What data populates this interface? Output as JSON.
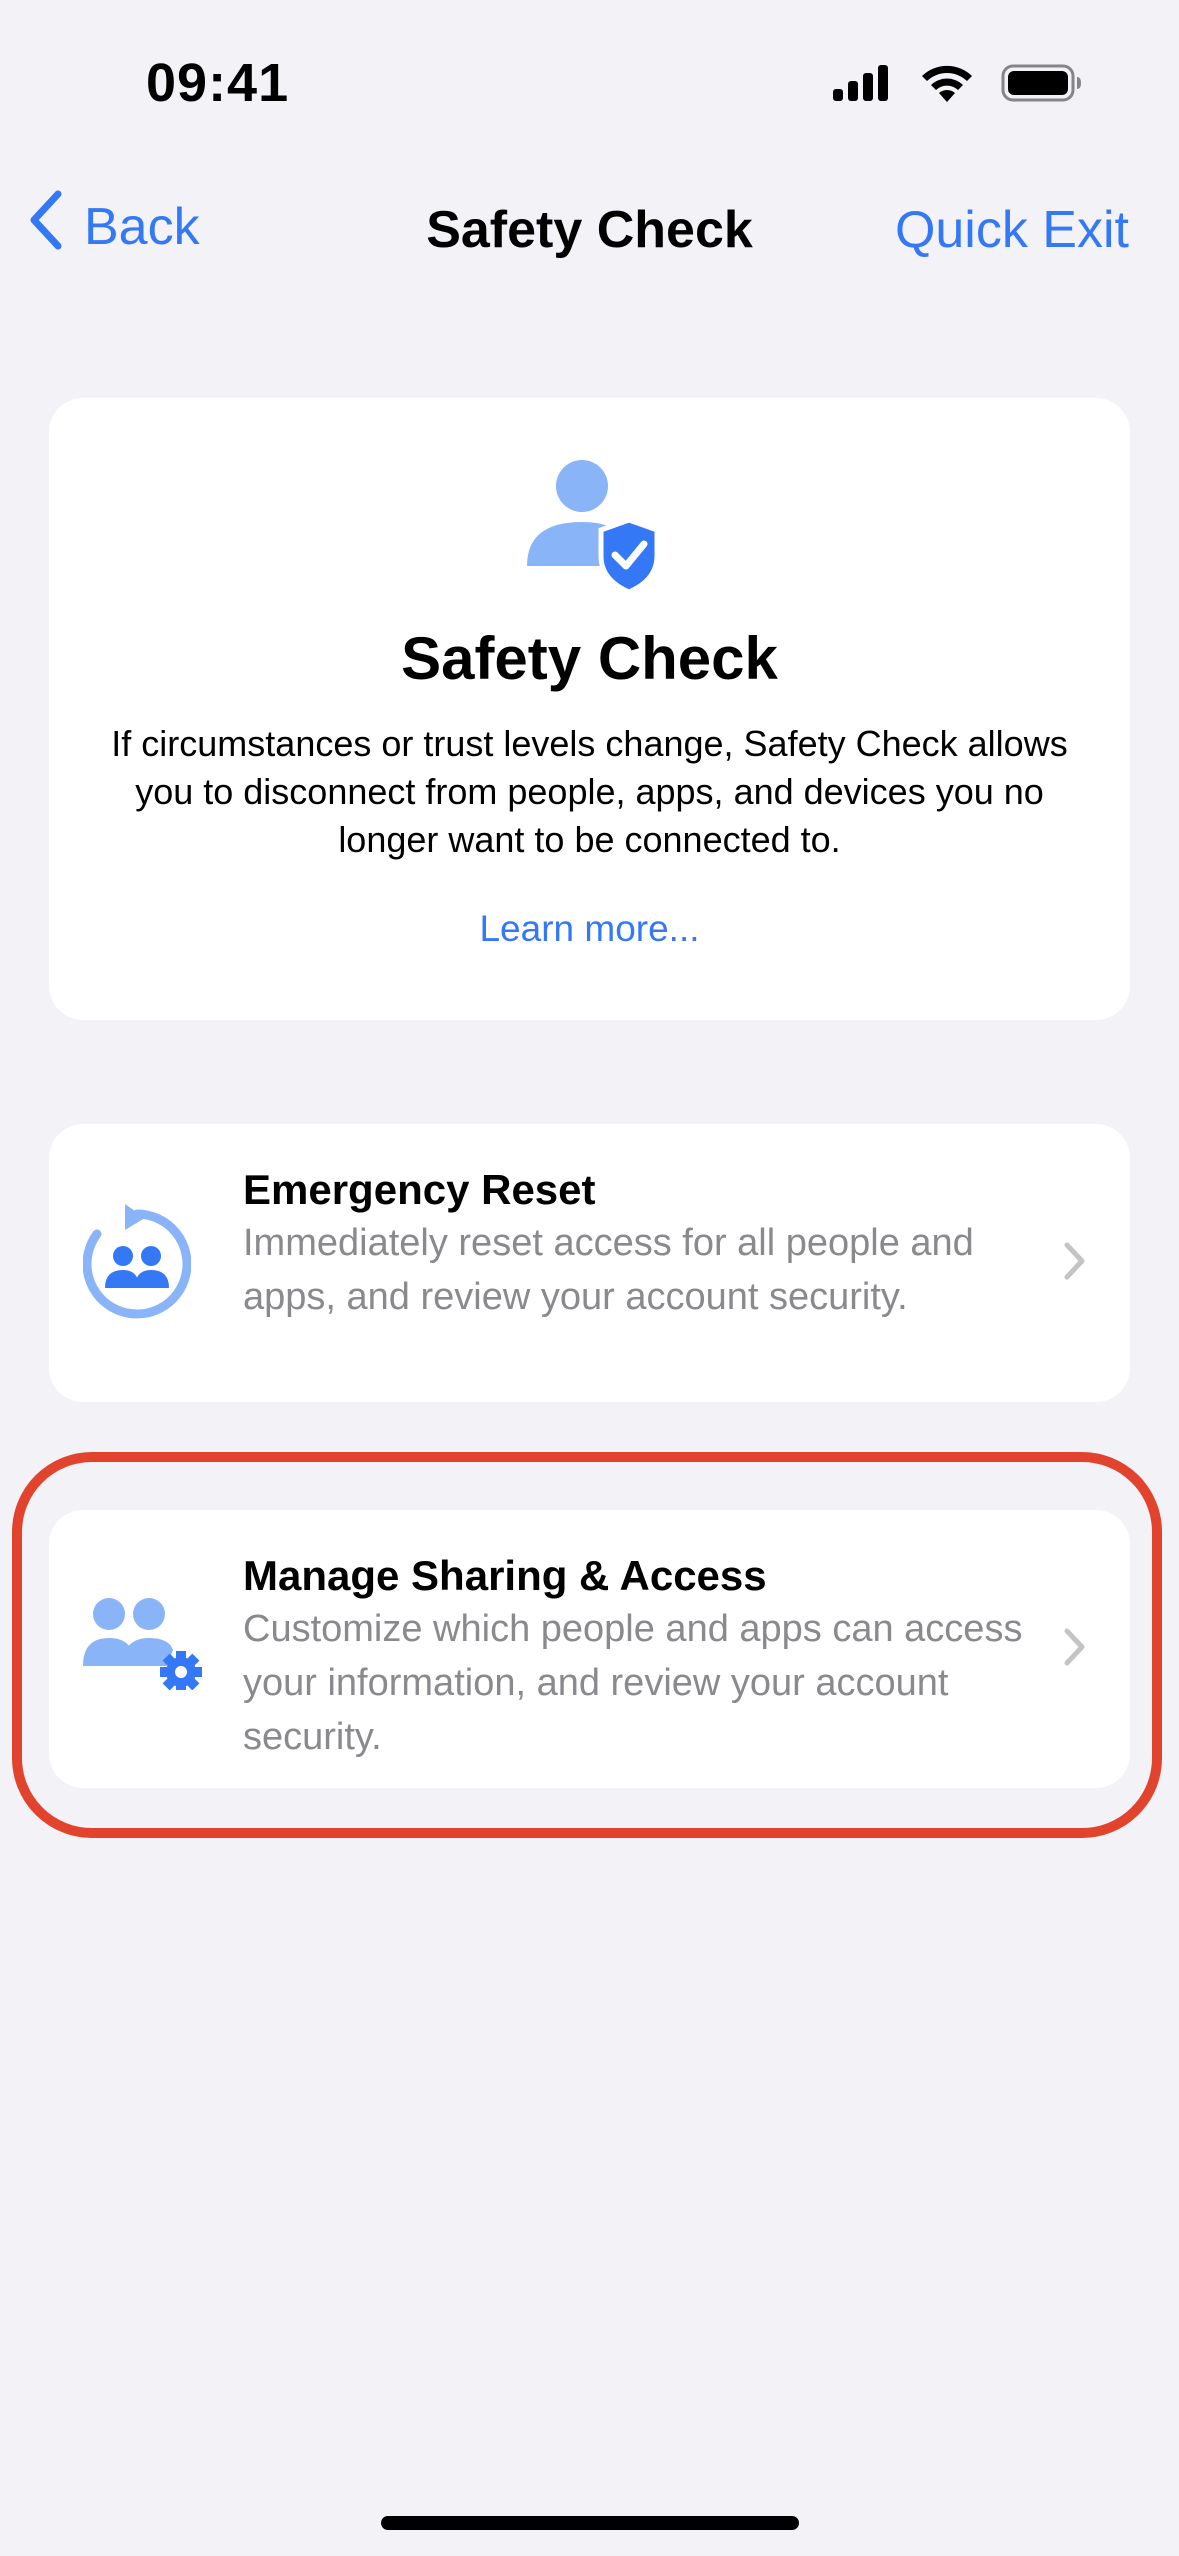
{
  "status_bar": {
    "time": "09:41",
    "icons": [
      "cellular-signal-icon",
      "wifi-icon",
      "battery-icon"
    ]
  },
  "nav": {
    "back_label": "Back",
    "title": "Safety Check",
    "quick_exit_label": "Quick Exit"
  },
  "hero": {
    "icon": "person-shield-icon",
    "title": "Safety Check",
    "description": "If circumstances or trust levels change, Safety Check allows you to disconnect from people, apps, and devices you no longer want to be connected to.",
    "link": "Learn more..."
  },
  "options": [
    {
      "icon": "emergency-reset-icon",
      "title": "Emergency Reset",
      "description": "Immediately reset access for all people and apps, and review your account security."
    },
    {
      "icon": "people-gear-icon",
      "title": "Manage Sharing & Access",
      "description": "Customize which people and apps can access your information, and review your account security."
    }
  ],
  "colors": {
    "accent": "#3478f6",
    "background": "#f2f2f7",
    "card": "#ffffff",
    "secondary_text": "#8a8a8e",
    "highlight": "#e2432d",
    "icon_light": "#8ab4f8",
    "icon_dark": "#3478f6"
  }
}
